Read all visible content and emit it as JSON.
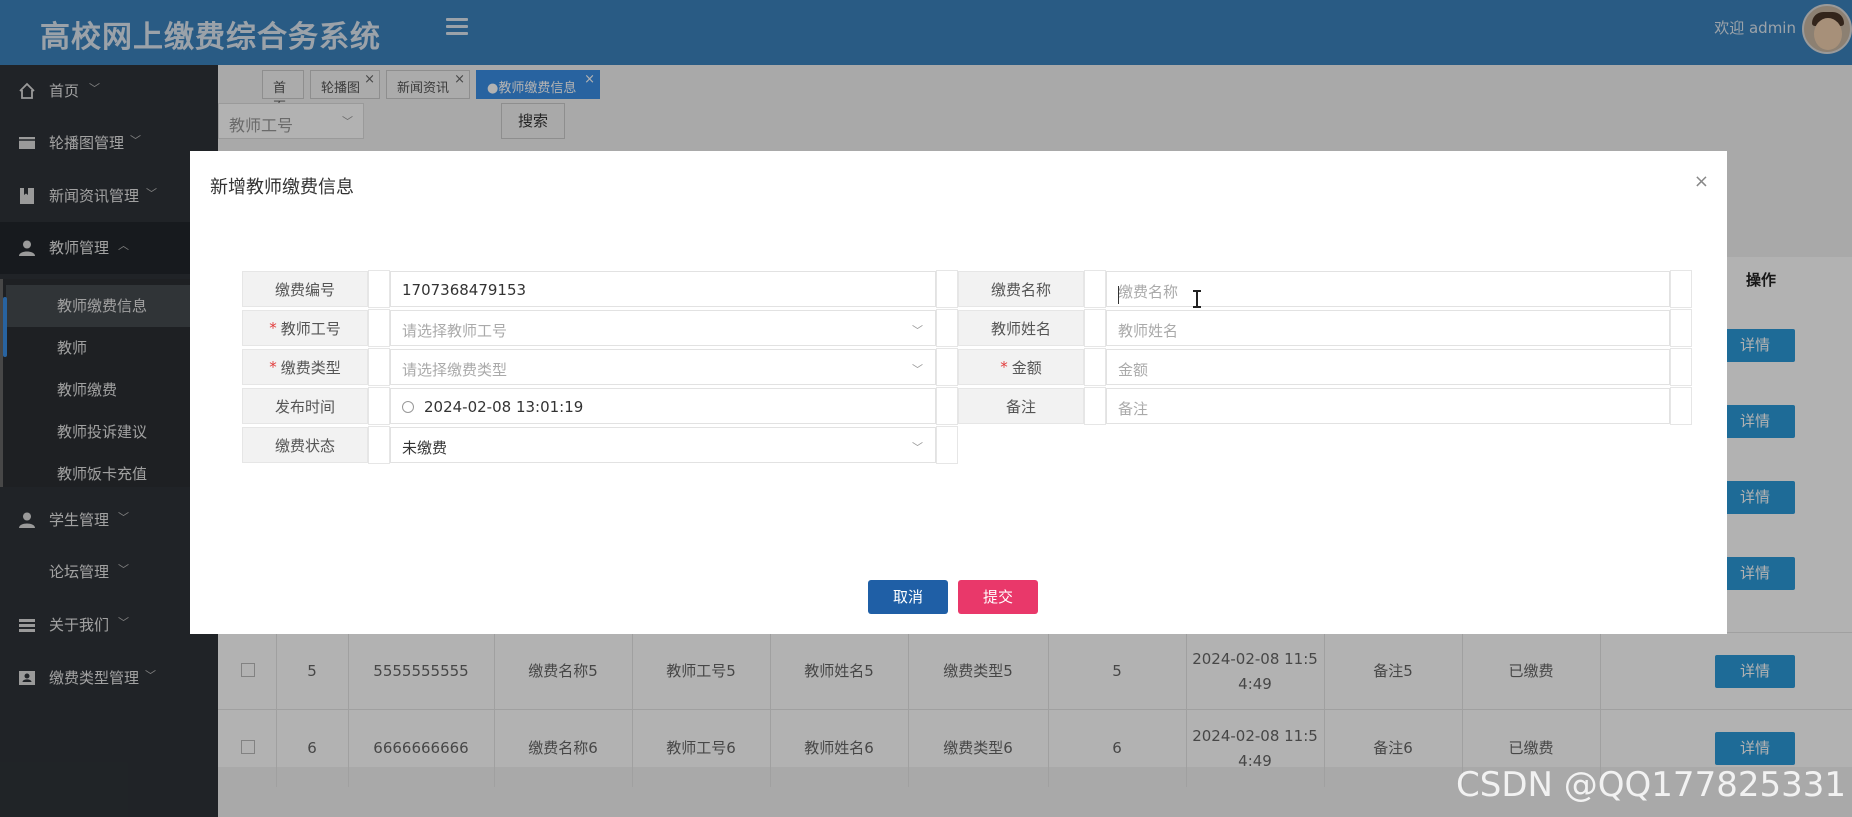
{
  "header": {
    "title": "高校网上缴费综合务系统",
    "welcome": "欢迎 admin"
  },
  "sidebar": {
    "items": [
      {
        "label": "首页",
        "icon": "home-icon"
      },
      {
        "label": "轮播图管理",
        "icon": "image-icon"
      },
      {
        "label": "新闻资讯管理",
        "icon": "bookmark-icon"
      },
      {
        "label": "教师管理",
        "icon": "user-icon"
      },
      {
        "label": "学生管理",
        "icon": "user-icon"
      },
      {
        "label": "论坛管理",
        "icon": ""
      },
      {
        "label": "关于我们",
        "icon": "list-icon"
      },
      {
        "label": "缴费类型管理",
        "icon": "id-card-icon"
      }
    ],
    "submenu": [
      "教师缴费信息",
      "教师",
      "教师缴费",
      "教师投诉建议",
      "教师饭卡充值"
    ]
  },
  "tabs": [
    {
      "label": "首页"
    },
    {
      "label": "轮播图"
    },
    {
      "label": "新闻资讯"
    },
    {
      "label": "●教师缴费信息"
    }
  ],
  "search": {
    "select_placeholder": "教师工号",
    "button": "搜索"
  },
  "table": {
    "op_header": "操作",
    "detail_label": "详情",
    "rows": [
      {
        "no": "5",
        "code": "5555555555",
        "name": "缴费名称5",
        "teacher_no": "教师工号5",
        "teacher_name": "教师姓名5",
        "type": "缴费类型5",
        "amount": "5",
        "time_a": "2024-02-08 11:5",
        "time_b": "4:49",
        "remark": "备注5",
        "status": "已缴费"
      },
      {
        "no": "6",
        "code": "6666666666",
        "name": "缴费名称6",
        "teacher_no": "教师工号6",
        "teacher_name": "教师姓名6",
        "type": "缴费类型6",
        "amount": "6",
        "time_a": "2024-02-08 11:5",
        "time_b": "4:49",
        "remark": "备注6",
        "status": "已缴费"
      }
    ]
  },
  "modal": {
    "title": "新增教师缴费信息",
    "close": "×",
    "fields": {
      "fee_no_label": "缴费编号",
      "fee_no_value": "1707368479153",
      "fee_name_label": "缴费名称",
      "fee_name_placeholder": "缴费名称",
      "teacher_no_label": "教师工号",
      "teacher_no_placeholder": "请选择教师工号",
      "teacher_name_label": "教师姓名",
      "teacher_name_placeholder": "教师姓名",
      "fee_type_label": "缴费类型",
      "fee_type_placeholder": "请选择缴费类型",
      "amount_label": "金额",
      "amount_placeholder": "金额",
      "publish_time_label": "发布时间",
      "publish_time_value": "2024-02-08 13:01:19",
      "remark_label": "备注",
      "remark_placeholder": "备注",
      "status_label": "缴费状态",
      "status_value": "未缴费"
    },
    "cancel": "取消",
    "submit": "提交"
  },
  "watermark": "CSDN @QQ177825331"
}
